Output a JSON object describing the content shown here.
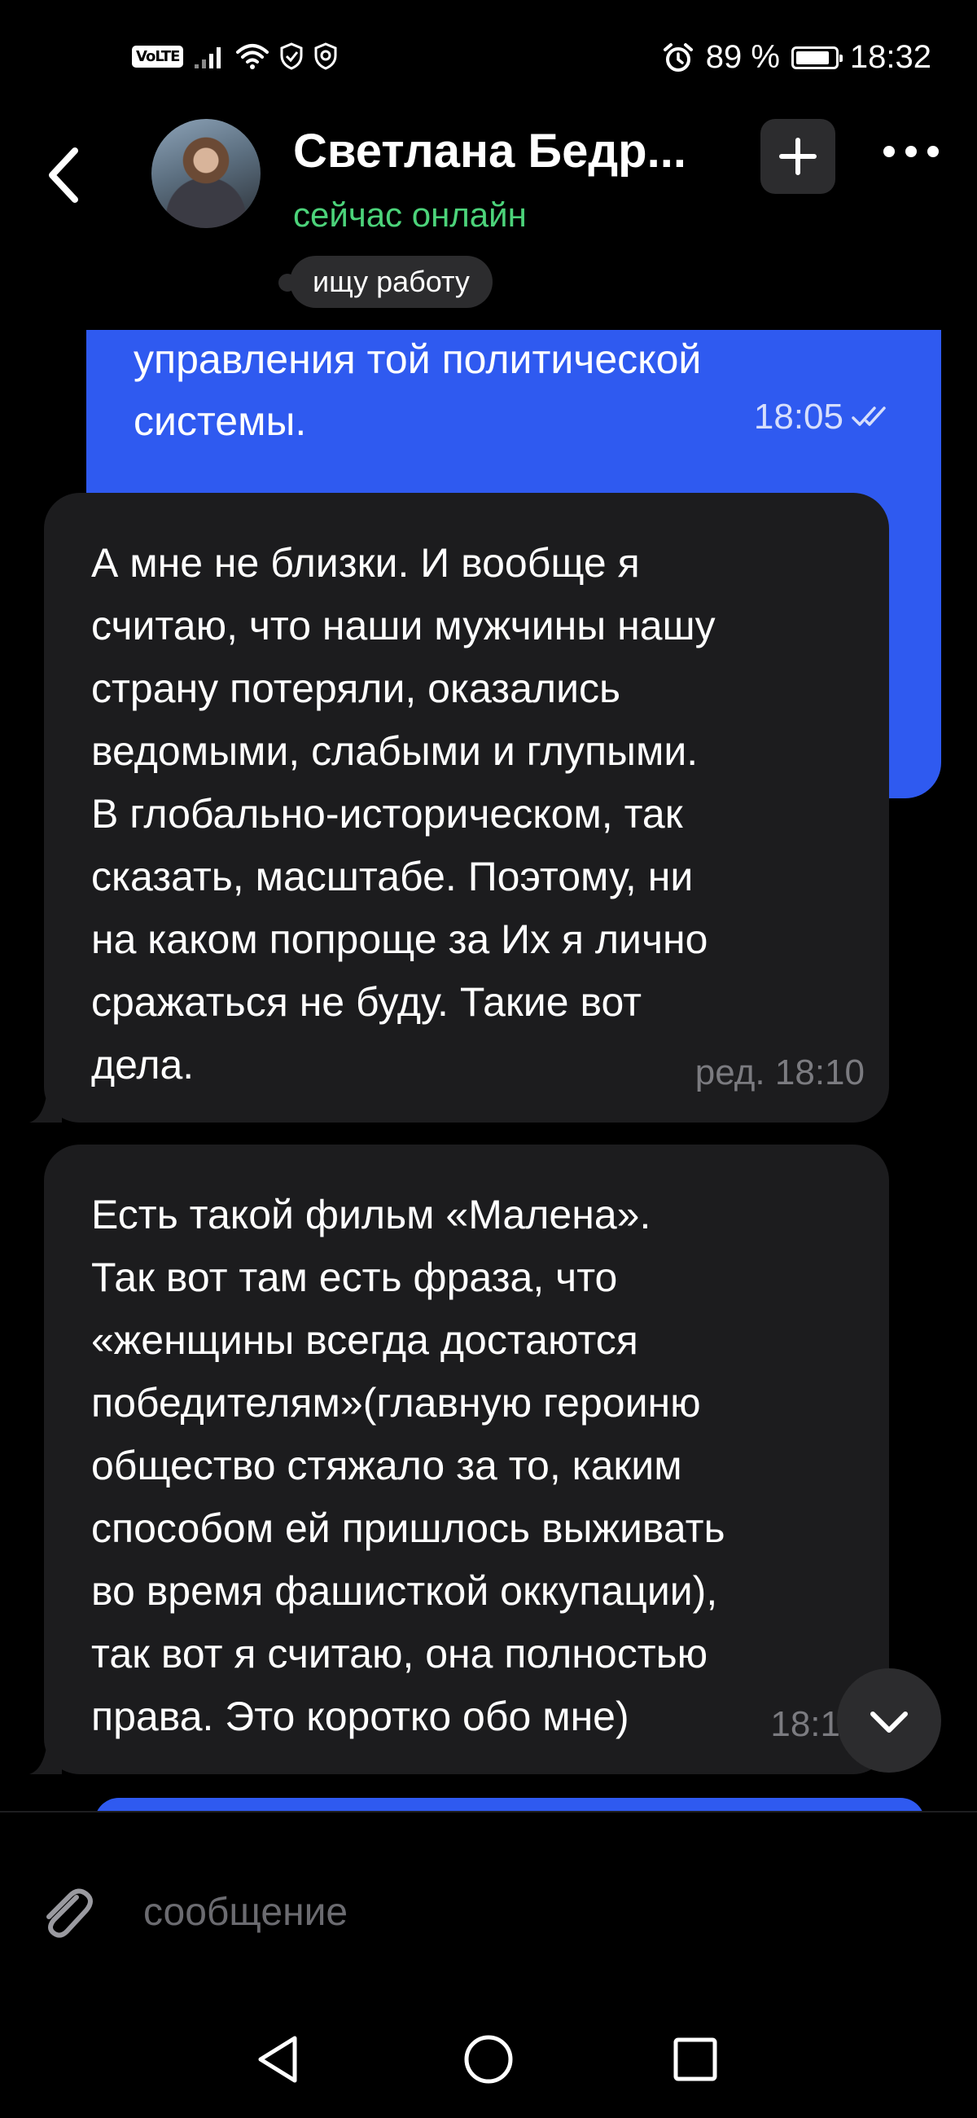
{
  "status_bar": {
    "network_badge": "VoLTE",
    "battery_percent": "89 %",
    "battery_level": 0.89,
    "time": "18:32",
    "icons": [
      "signal-icon",
      "wifi-icon",
      "shield-icon",
      "shield-check-icon",
      "alarm-icon",
      "battery-icon"
    ]
  },
  "header": {
    "contact_name": "Светлана Бедр...",
    "presence": "сейчас онлайн",
    "status_note": "ищу работу"
  },
  "messages": [
    {
      "direction": "outgoing",
      "text": "управления той политической системы.",
      "time": "18:05",
      "read": true
    },
    {
      "direction": "incoming",
      "text": "А мне не близки. И вообще я\nсчитаю, что наши мужчины нашу\nстрану потеряли, оказались\nведомыми, слабыми и глупыми.\nВ глобально-историческом, так\nсказать, масштабе. Поэтому, ни\nна каком попроще за Их я лично\nсражаться не буду. Такие вот\nдела.",
      "time": "ред. 18:10"
    },
    {
      "direction": "incoming",
      "text": "Есть такой фильм «Малена».\nТак вот там есть фраза, что\n«женщины всегда достаются\nпобедителям»(главную героиню\nобщество стяжало за то, каким\nспособом ей пришлось выживать\nво время фашисткой оккупации),\nтак вот я считаю, она полностью\nправа. Это коротко обо мне)",
      "time": "18:1"
    }
  ],
  "composer": {
    "placeholder": "сообщение"
  },
  "colors": {
    "background": "#000000",
    "outgoing_bubble": "#2f5af0",
    "incoming_bubble": "#1c1c1e",
    "online_green": "#4cd37a",
    "muted_text": "#7b7b80"
  }
}
